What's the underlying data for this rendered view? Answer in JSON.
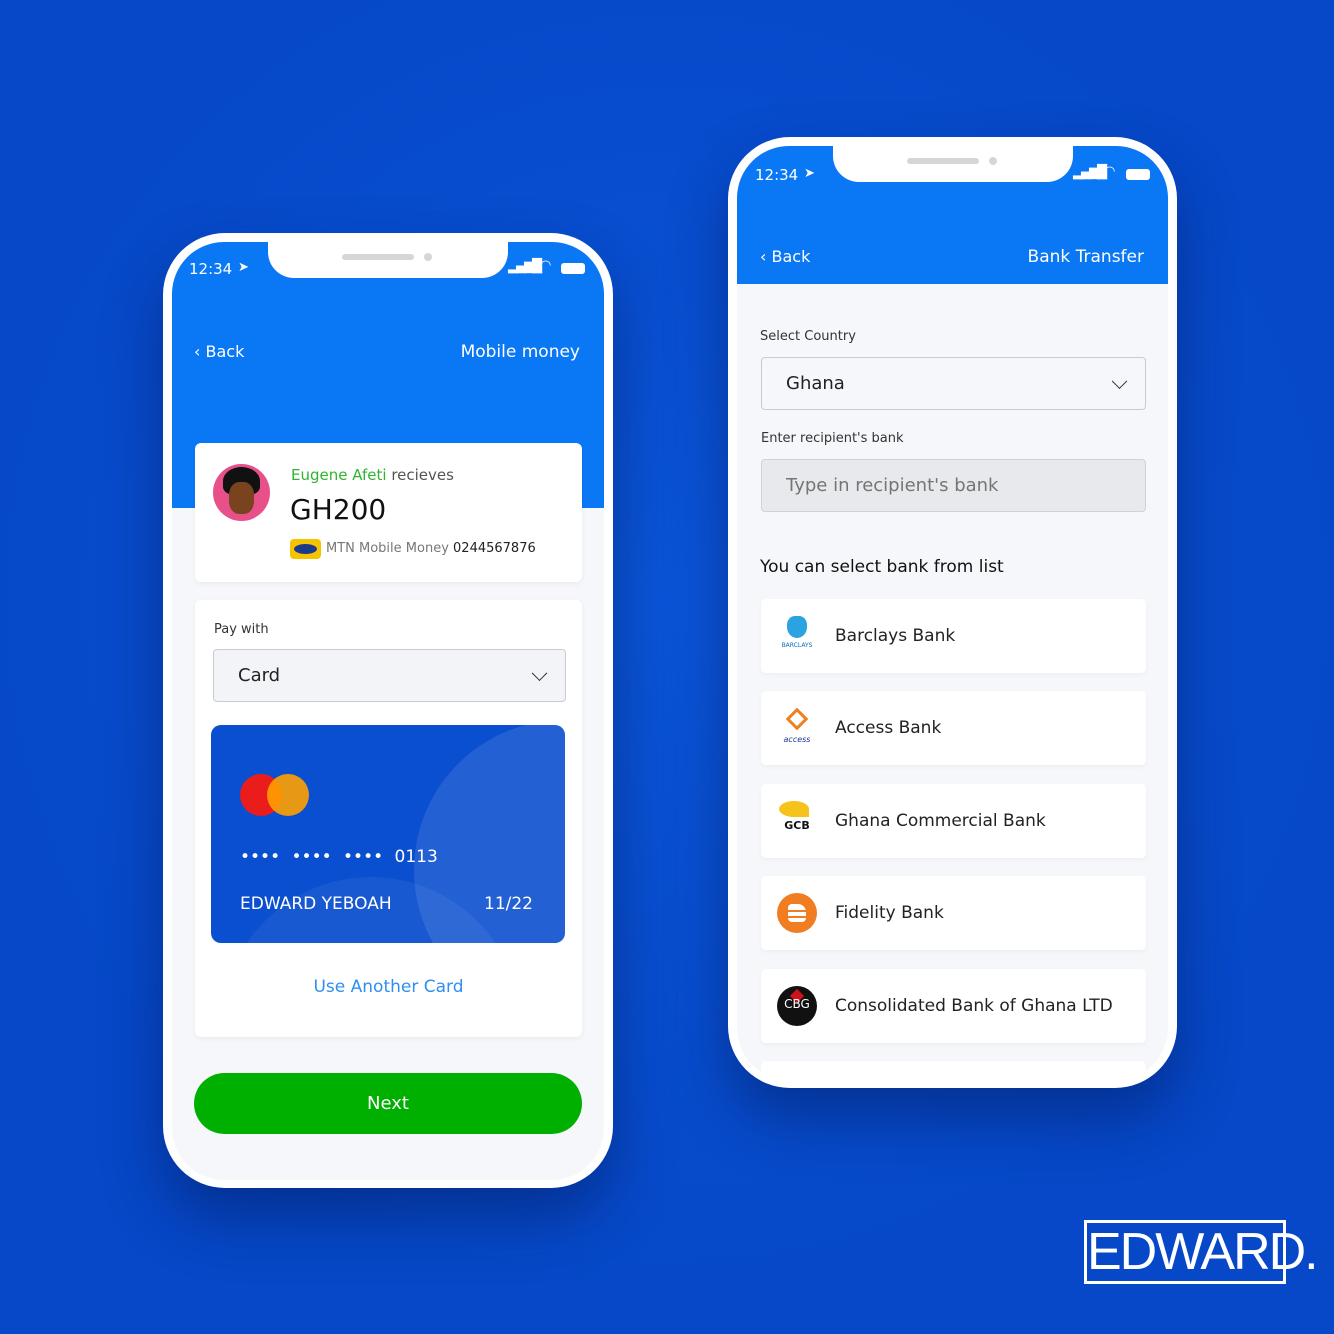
{
  "status": {
    "time": "12:34"
  },
  "left": {
    "back": "Back",
    "title": "Mobile money",
    "recipient": {
      "name": "Eugene Afeti",
      "verb": "recieves",
      "amount": "GH200",
      "provider": "MTN Mobile Money",
      "phone": "0244567876",
      "provider_logo": "MTN"
    },
    "pay_with_label": "Pay with",
    "pay_with_value": "Card",
    "credit_card": {
      "masked": [
        "••••",
        "••••",
        "••••"
      ],
      "last4": "0113",
      "holder": "EDWARD YEBOAH",
      "expiry": "11/22"
    },
    "another_card": "Use Another Card",
    "next": "Next"
  },
  "right": {
    "back": "Back",
    "title": "Bank Transfer",
    "country_label": "Select Country",
    "country_value": "Ghana",
    "bank_label": "Enter recipient's bank",
    "bank_placeholder": "Type in recipient's bank",
    "list_heading": "You can select bank from list",
    "banks": [
      {
        "name": "Barclays Bank",
        "logo": "BARCLAYS"
      },
      {
        "name": "Access Bank",
        "logo": "access"
      },
      {
        "name": "Ghana Commercial Bank",
        "logo": "GCB"
      },
      {
        "name": "Fidelity Bank",
        "logo": "fidelity"
      },
      {
        "name": "Consolidated Bank of Ghana LTD",
        "logo": "CBG"
      }
    ]
  },
  "brand": "EDWARD.",
  "colors": {
    "background": "#0648c8",
    "header": "#0a77f5",
    "next": "#00b000",
    "recipient": "#2fb52f",
    "link": "#2e8ff0"
  }
}
